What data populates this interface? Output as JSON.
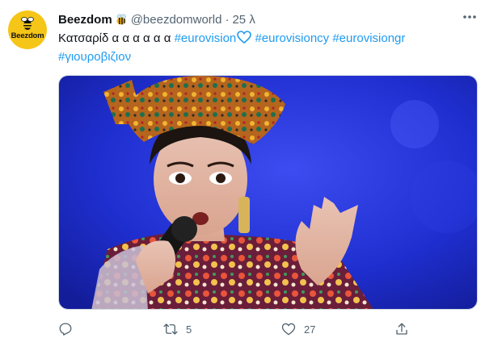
{
  "account": {
    "display_name": "Beezdom",
    "handle": "@beezdomworld",
    "separator": "·",
    "time": "25 λ",
    "avatar_text": "Beezdom"
  },
  "tweet": {
    "line1_text": "Κατσαρίδ α α α α α α",
    "hashtag_eurovision": "#eurovision",
    "hashtag_eurovisioncy": "#eurovisioncy",
    "hashtag_eurovisiongr": "#eurovisiongr",
    "hashtag_greek": "#γιουροβιζιον"
  },
  "actions": {
    "reply_count": "",
    "retweet_count": "5",
    "like_count": "27"
  },
  "icons": {
    "more": "more-dots-icon",
    "reply": "reply-icon",
    "retweet": "retweet-icon",
    "like": "heart-icon",
    "share": "share-icon",
    "bee": "bee-emoji-icon",
    "blue_heart": "blue-heart-emoji-icon"
  },
  "colors": {
    "hashtag": "#1d9bf0",
    "secondary_text": "#536471",
    "avatar_bg": "#f5c518",
    "media_bg": "#1f2fd0"
  }
}
